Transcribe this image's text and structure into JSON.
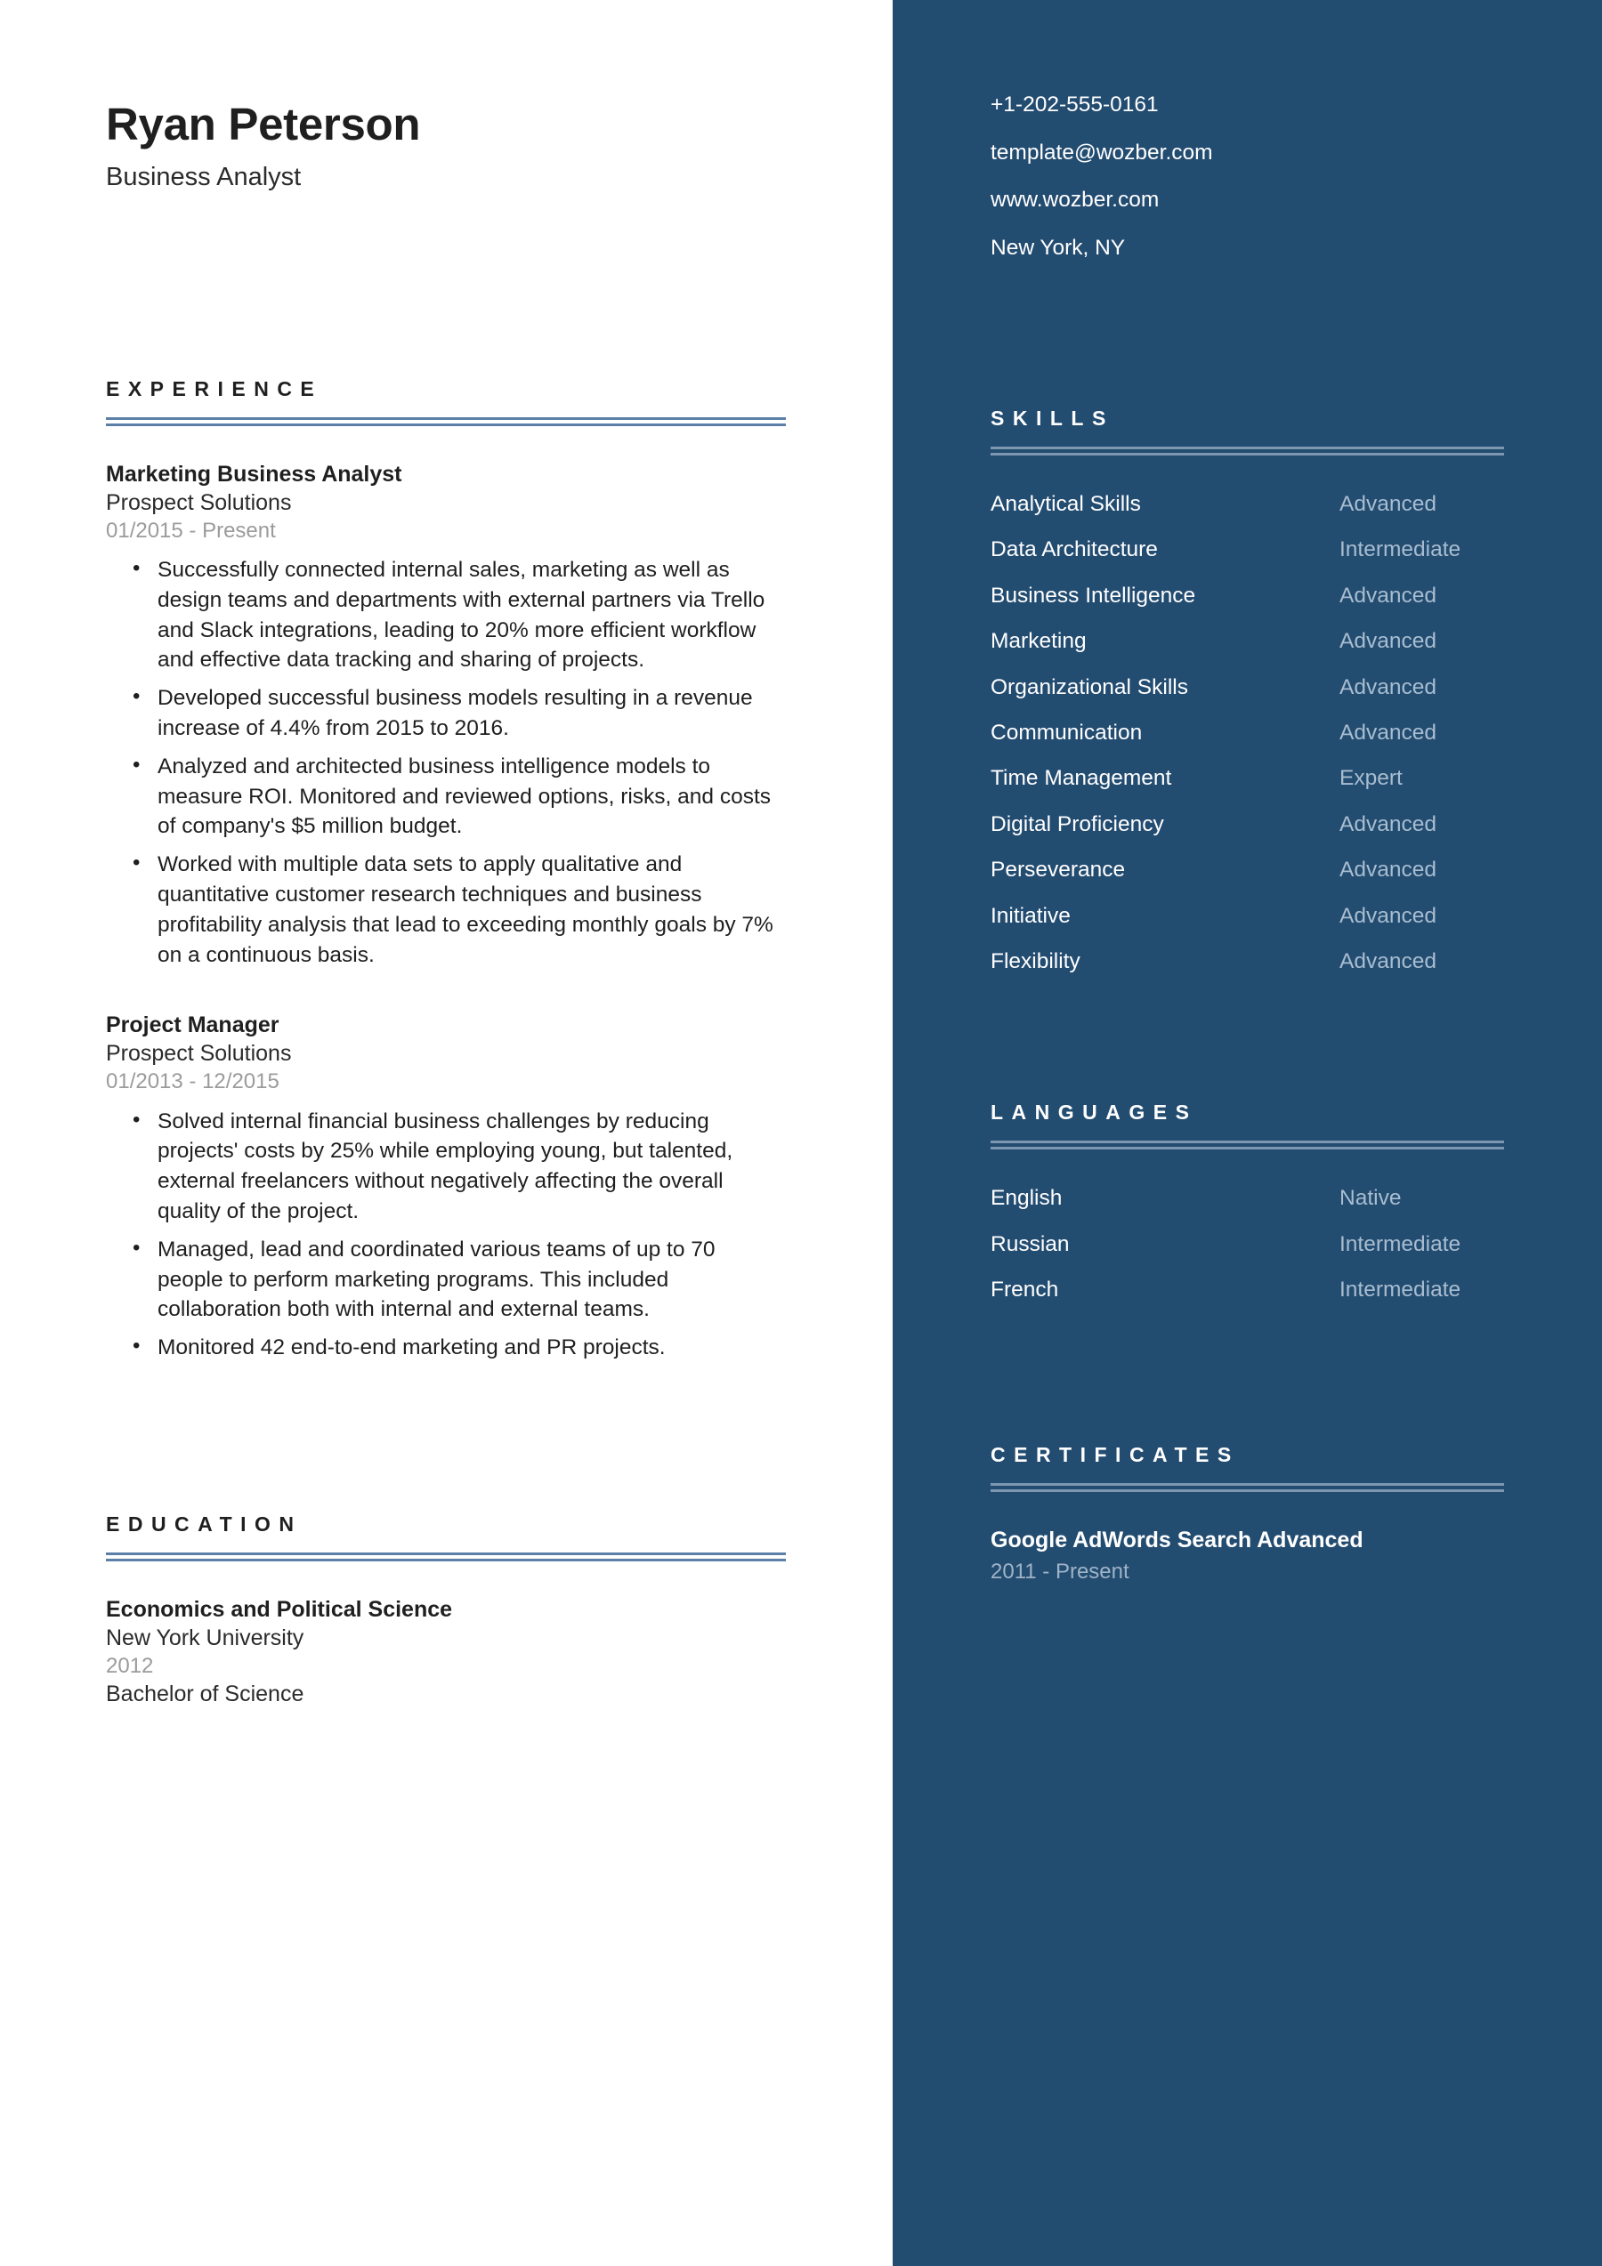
{
  "theme": {
    "sidebar_bg": "#234C71",
    "page_bg": "#FFFFFF",
    "accent_rule_main": "#5B7FA6",
    "accent_rule_side": "#7D97B0",
    "muted_text_main": "#9B9B9B",
    "muted_text_side": "#A8BDD0"
  },
  "header": {
    "full_name": "Ryan Peterson",
    "job_title": "Business Analyst"
  },
  "contact": {
    "phone": "+1-202-555-0161",
    "email": "template@wozber.com",
    "website": "www.wozber.com",
    "location": "New York, NY"
  },
  "experience": {
    "section_title": "EXPERIENCE",
    "entries": [
      {
        "title": "Marketing Business Analyst",
        "organization": "Prospect Solutions",
        "date": "01/2015 - Present",
        "bullets": [
          "Successfully connected internal sales, marketing as well as design teams and departments with external partners via Trello and Slack integrations, leading to 20% more efficient workflow and effective data tracking and sharing of projects.",
          "Developed successful business models resulting in a revenue increase of 4.4% from 2015 to 2016.",
          "Analyzed and architected business intelligence models to measure ROI. Monitored and reviewed options, risks, and costs of company's $5 million budget.",
          "Worked with multiple data sets to apply qualitative and quantitative customer research techniques and business profitability analysis that lead to exceeding monthly goals by 7% on a continuous basis."
        ]
      },
      {
        "title": "Project Manager",
        "organization": "Prospect Solutions",
        "date": "01/2013 - 12/2015",
        "bullets": [
          "Solved internal financial business challenges by reducing projects' costs by 25% while employing young, but talented, external freelancers without negatively affecting the overall quality of the project.",
          "Managed, lead and coordinated various teams of up to 70 people to perform marketing programs. This included collaboration both with internal and external teams.",
          "Monitored 42 end-to-end marketing and PR projects."
        ]
      }
    ]
  },
  "education": {
    "section_title": "EDUCATION",
    "entries": [
      {
        "field": "Economics and Political Science",
        "school": "New York University",
        "year": "2012",
        "degree": "Bachelor of Science"
      }
    ]
  },
  "skills": {
    "section_title": "SKILLS",
    "items": [
      {
        "name": "Analytical Skills",
        "level": "Advanced"
      },
      {
        "name": "Data Architecture",
        "level": "Intermediate"
      },
      {
        "name": "Business Intelligence",
        "level": "Advanced"
      },
      {
        "name": "Marketing",
        "level": "Advanced"
      },
      {
        "name": "Organizational Skills",
        "level": "Advanced"
      },
      {
        "name": "Communication",
        "level": "Advanced"
      },
      {
        "name": "Time Management",
        "level": "Expert"
      },
      {
        "name": "Digital Proficiency",
        "level": "Advanced"
      },
      {
        "name": "Perseverance",
        "level": "Advanced"
      },
      {
        "name": "Initiative",
        "level": "Advanced"
      },
      {
        "name": "Flexibility",
        "level": "Advanced"
      }
    ]
  },
  "languages": {
    "section_title": "LANGUAGES",
    "items": [
      {
        "name": "English",
        "level": "Native"
      },
      {
        "name": "Russian",
        "level": "Intermediate"
      },
      {
        "name": "French",
        "level": "Intermediate"
      }
    ]
  },
  "certificates": {
    "section_title": "CERTIFICATES",
    "items": [
      {
        "name": "Google AdWords Search Advanced",
        "date": "2011 - Present"
      }
    ]
  }
}
